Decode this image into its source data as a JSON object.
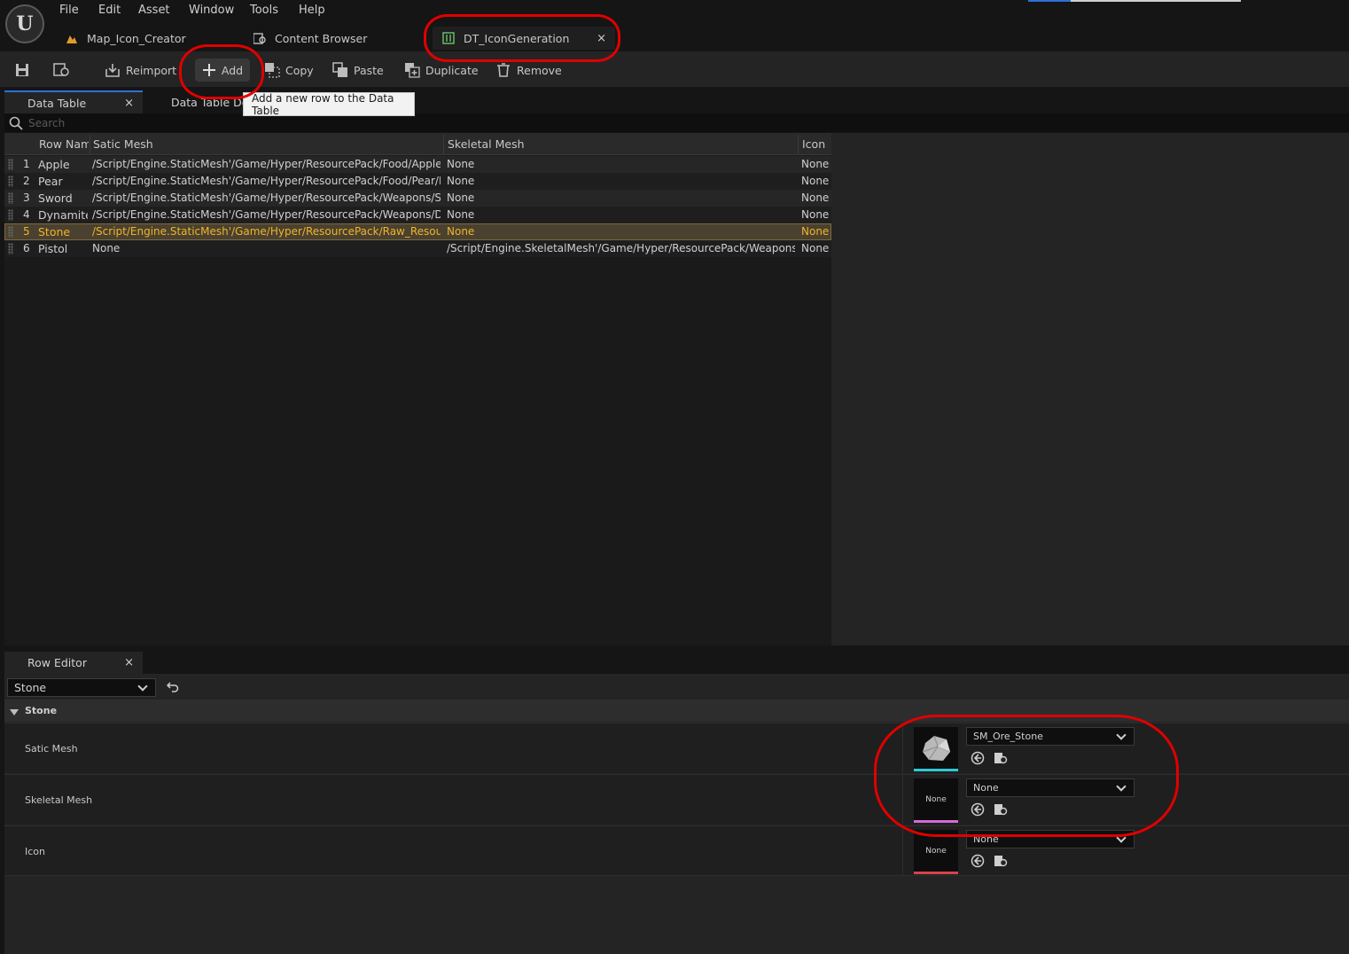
{
  "menu": {
    "logo": "U",
    "items": [
      "File",
      "Edit",
      "Asset",
      "Window",
      "Tools",
      "Help"
    ]
  },
  "doc_tabs": [
    {
      "label": "Map_Icon_Creator"
    },
    {
      "label": "Content Browser"
    },
    {
      "label": "DT_IconGeneration",
      "close": "×"
    }
  ],
  "toolbar": {
    "reimport": "Reimport",
    "add": "Add",
    "copy": "Copy",
    "paste": "Paste",
    "duplicate": "Duplicate",
    "remove": "Remove"
  },
  "tooltip": "Add a new row to the Data Table",
  "panels": {
    "data_table": "Data Table",
    "data_table_details": "Data Table De",
    "close": "×"
  },
  "search": {
    "placeholder": "Search"
  },
  "table": {
    "headers": [
      "Row Nam",
      "Satic Mesh",
      "Skeletal Mesh",
      "Icon"
    ],
    "rows": [
      {
        "num": "1",
        "name": "Apple",
        "static": "/Script/Engine.StaticMesh'/Game/Hyper/ResourcePack/Food/Apple_Foo",
        "skeletal": "None",
        "icon": "None"
      },
      {
        "num": "2",
        "name": "Pear",
        "static": "/Script/Engine.StaticMesh'/Game/Hyper/ResourcePack/Food/Pear/Mesh",
        "skeletal": "None",
        "icon": "None"
      },
      {
        "num": "3",
        "name": "Sword",
        "static": "/Script/Engine.StaticMesh'/Game/Hyper/ResourcePack/Weapons/Sword",
        "skeletal": "None",
        "icon": "None"
      },
      {
        "num": "4",
        "name": "Dynamite",
        "static": "/Script/Engine.StaticMesh'/Game/Hyper/ResourcePack/Weapons/Dynam",
        "skeletal": "None",
        "icon": "None"
      },
      {
        "num": "5",
        "name": "Stone",
        "static": "/Script/Engine.StaticMesh'/Game/Hyper/ResourcePack/Raw_Resources/",
        "skeletal": "None",
        "icon": "None",
        "selected": true
      },
      {
        "num": "6",
        "name": "Pistol",
        "static": "None",
        "skeletal": "/Script/Engine.SkeletalMesh'/Game/Hyper/ResourcePack/Weapons/Pisto",
        "icon": "None"
      }
    ]
  },
  "row_editor": {
    "tab": "Row Editor",
    "selected_row": "Stone",
    "category": "Stone",
    "properties": [
      {
        "label": "Satic Mesh",
        "thumb": "",
        "value": "SM_Ore_Stone",
        "accent": "#2ec9d6"
      },
      {
        "label": "Skeletal Mesh",
        "thumb": "None",
        "value": "None",
        "accent": "#d46bd8"
      },
      {
        "label": "Icon",
        "thumb": "None",
        "value": "None",
        "accent": "#d8434b"
      }
    ]
  },
  "colors": {
    "selection_text": "#f0b429",
    "tab_accent": "#2f6fd8",
    "annotation": "#e00000"
  }
}
